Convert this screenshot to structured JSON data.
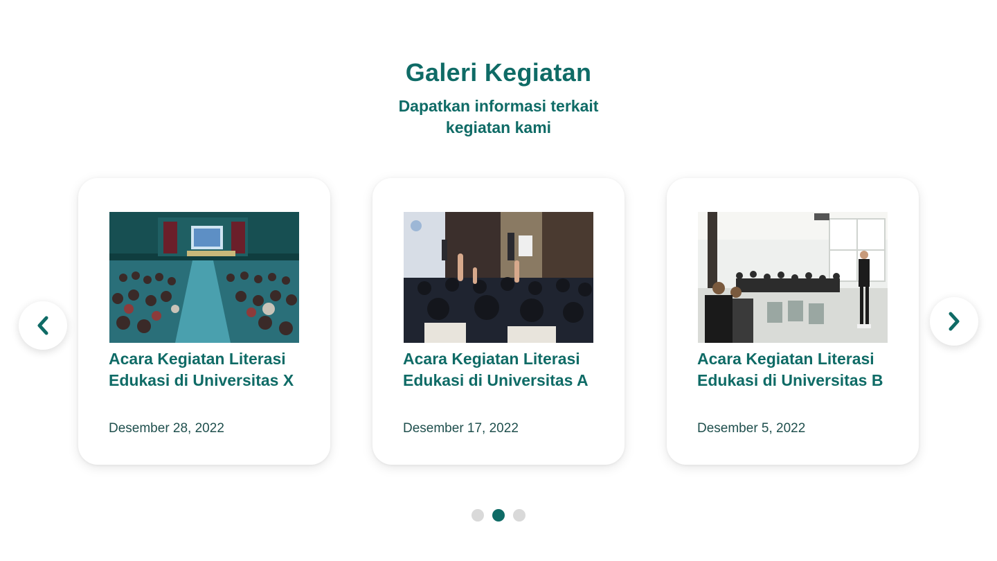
{
  "section": {
    "title": "Galeri Kegiatan",
    "subtitle": "Dapatkan informasi terkait kegiatan kami"
  },
  "colors": {
    "brand": "#0f6b66",
    "dot_inactive": "#d9d9d9",
    "background": "#ffffff"
  },
  "carousel": {
    "prev_icon": "chevron-left-icon",
    "next_icon": "chevron-right-icon",
    "active_index": 1,
    "dot_count": 3,
    "cards": [
      {
        "title": "Acara Kegiatan Literasi Edukasi di Universitas X",
        "date": "Desember 28, 2022",
        "image": "auditorium-lecture-photo"
      },
      {
        "title": "Acara Kegiatan Literasi Edukasi di Universitas A",
        "date": "Desember 17, 2022",
        "image": "audience-raising-hands-photo"
      },
      {
        "title": "Acara Kegiatan Literasi Edukasi di Universitas B",
        "date": "Desember 5, 2022",
        "image": "workshop-speaker-photo"
      }
    ]
  }
}
